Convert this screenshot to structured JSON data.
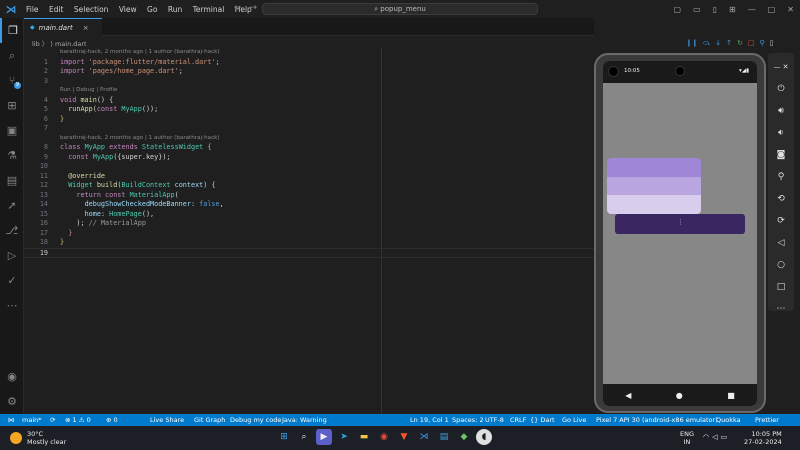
{
  "menu": [
    "File",
    "Edit",
    "Selection",
    "View",
    "Go",
    "Run",
    "Terminal",
    "Help"
  ],
  "search_text": "popup_menu",
  "tab": {
    "label": "main.dart",
    "close": "×"
  },
  "breadcrumb": "lib  〉 ⟩ main.dart",
  "blame1": "barathraj-hack, 2 months ago | 1 author (barathraj-hack)",
  "runlens": "Run | Debug | Profile",
  "blame2": "barathraj-hack, 2 months ago | 1 author (barathraj-hack)",
  "code": {
    "l1_kw": "import",
    "l1_str": "'package:flutter/material.dart'",
    "l2_kw": "import",
    "l2_str": "'pages/home_page.dart'",
    "l4_kw": "void",
    "l4_fn": "main",
    "l4_rest": "() {",
    "l5_fn": "runApp",
    "l5_kw": "const",
    "l5_ty": "MyApp",
    "l5_rest": "());",
    "l6": "}",
    "l8_kw": "class",
    "l8_ty": "MyApp",
    "l8_kw2": "extends",
    "l8_ty2": "StatelessWidget",
    "l8_rest": "{",
    "l9_kw": "const",
    "l9_ty": "MyApp",
    "l9_rest": "({super.key});",
    "l11": "@override",
    "l12_ty": "Widget",
    "l12_fn": "build",
    "l12_ty2": "BuildContext",
    "l12_rest": "context) {",
    "l13_kw": "return",
    "l13_kw2": "const",
    "l13_ty": "MaterialApp",
    "l14_prop": "debugShowCheckedModeBanner",
    "l14_bool": "false",
    "l15_prop": "home",
    "l15_ty": "HomePage",
    "l15_rest": "(),",
    "l16_rest": "); ",
    "l16_cm": "// MaterialApp",
    "l17": "}",
    "l18": "}"
  },
  "line_numbers": [
    "1",
    "2",
    "3",
    "4",
    "5",
    "6",
    "7",
    "8",
    "9",
    "10",
    "11",
    "12",
    "13",
    "14",
    "15",
    "16",
    "17",
    "18",
    "19"
  ],
  "phone": {
    "time": "10:05",
    "status_icons": "▾◢▮",
    "nav_back": "◀",
    "nav_home": "●",
    "nav_recent": "■",
    "menu_colors": [
      "#9f86d6",
      "#b9a6e0",
      "#d9cdee"
    ],
    "button_color": "#3a2660",
    "dots": "⋮"
  },
  "statusbar": {
    "branch": "main*",
    "sync": "⟳",
    "errors": "⊗ 1 ⚠ 0",
    "ports": "⊕ 0",
    "live_share": "Live Share",
    "git_graph": "Git Graph",
    "debug": "Debug my code",
    "java": "Java: Warning",
    "position": "Ln 19, Col 1",
    "spaces": "Spaces: 2",
    "encoding": "UTF-8",
    "eol": "CRLF",
    "lang": "{} Dart",
    "golive": "Go Live",
    "device": "Pixel 7 API 30 (android-x86 emulator)",
    "quokka": "Quokka",
    "prettier": "Prettier"
  },
  "taskbar": {
    "temp": "30°C",
    "weather": "Mostly clear",
    "lang1": "ENG",
    "lang2": "IN",
    "time": "10:05 PM",
    "date": "27-02-2024"
  }
}
